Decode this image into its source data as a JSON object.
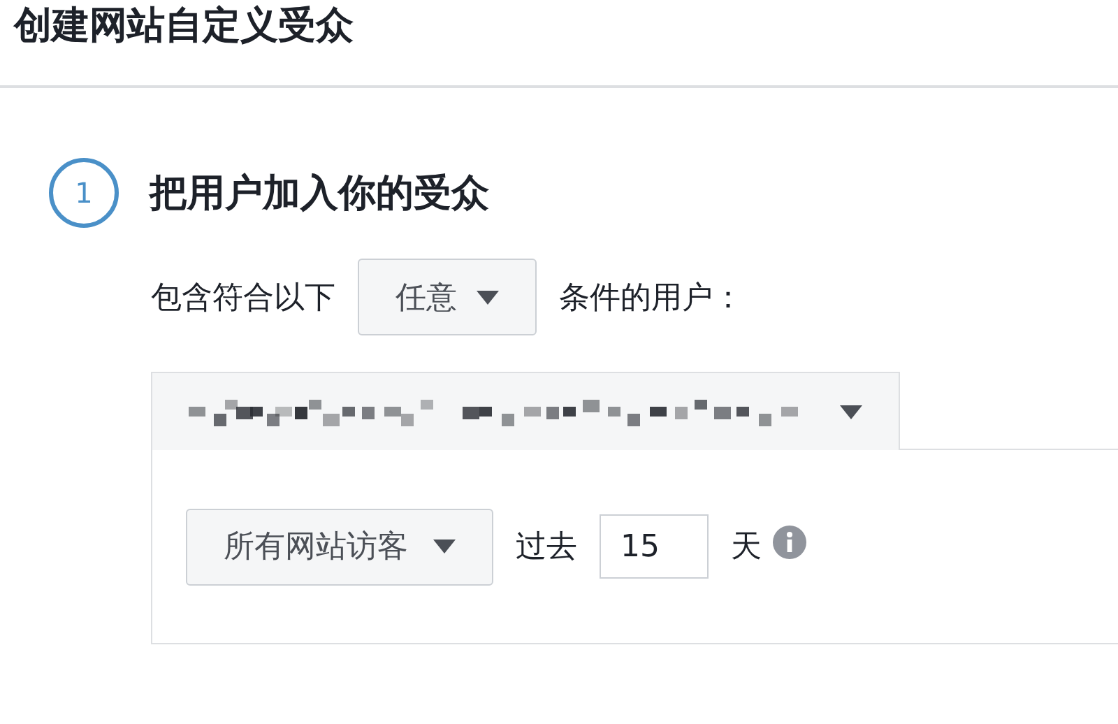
{
  "header": {
    "title": "创建网站自定义受众"
  },
  "step": {
    "number": "1",
    "title": "把用户加入你的受众"
  },
  "match_row": {
    "prefix": "包含符合以下",
    "dropdown": "任意",
    "suffix": "条件的用户："
  },
  "rule": {
    "event_dropdown": "所有网站访客",
    "before_days": "过去",
    "days_value": "15",
    "unit": "天"
  }
}
